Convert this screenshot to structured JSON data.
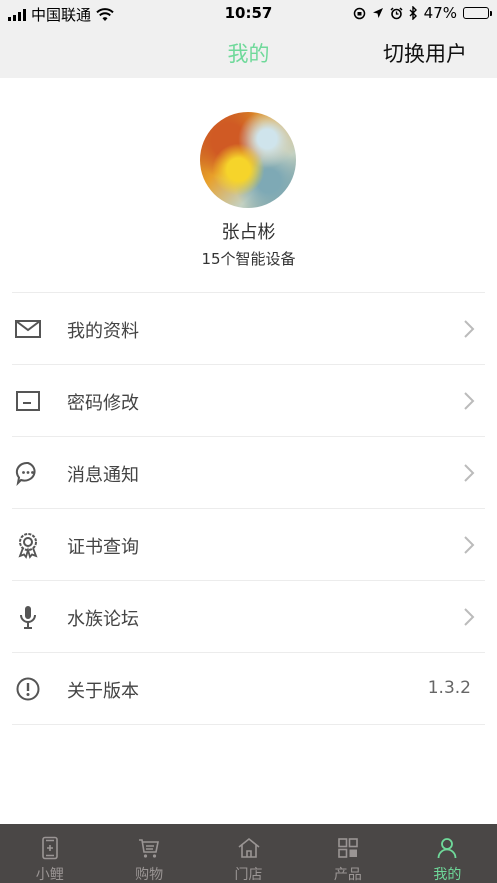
{
  "status_bar": {
    "carrier": "中国联通",
    "time": "10:57",
    "battery": "47%",
    "battery_level": 0.47
  },
  "nav": {
    "title": "我的",
    "action": "切换用户"
  },
  "profile": {
    "name": "张占彬",
    "devices": "15个智能设备"
  },
  "menu": {
    "items": [
      {
        "label": "我的资料",
        "icon": "mail-icon"
      },
      {
        "label": "密码修改",
        "icon": "password-icon"
      },
      {
        "label": "消息通知",
        "icon": "chat-bubble-icon"
      },
      {
        "label": "证书查询",
        "icon": "badge-icon"
      },
      {
        "label": "水族论坛",
        "icon": "microphone-icon"
      },
      {
        "label": "关于版本",
        "icon": "info-icon",
        "value": "1.3.2"
      }
    ]
  },
  "tabs": [
    {
      "label": "小鲤",
      "icon": "phone-plus-icon"
    },
    {
      "label": "购物",
      "icon": "cart-icon"
    },
    {
      "label": "门店",
      "icon": "home-icon"
    },
    {
      "label": "产品",
      "icon": "grid-icon"
    },
    {
      "label": "我的",
      "icon": "user-icon",
      "active": true
    }
  ],
  "colors": {
    "accent": "#6fd99a",
    "tab_bar_bg": "#4a4746",
    "nav_bg": "#f0f0f0"
  }
}
